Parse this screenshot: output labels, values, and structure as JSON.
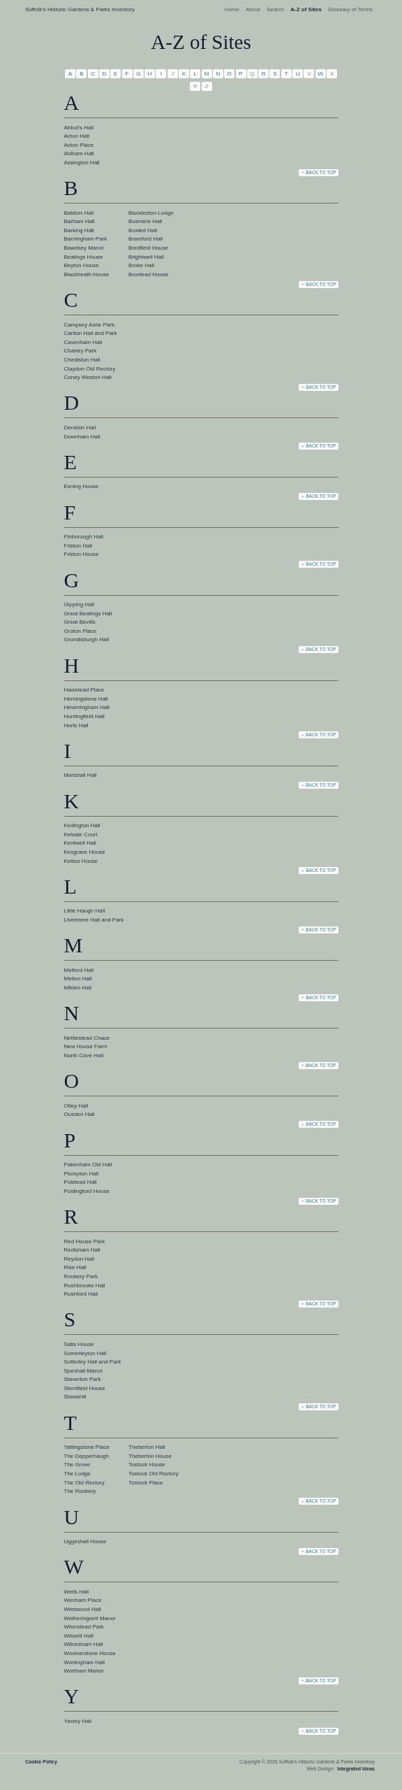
{
  "header": {
    "brand": "Suffolk's Historic Gardens & Parks Inventory",
    "nav": [
      {
        "label": "Home",
        "selected": false
      },
      {
        "label": "About",
        "selected": false
      },
      {
        "label": "Search",
        "selected": false
      },
      {
        "label": "A-Z of Sites",
        "selected": true
      },
      {
        "label": "Glossary of Terms",
        "selected": false
      }
    ]
  },
  "title": "A-Z of Sites",
  "letter_index": [
    {
      "label": "A",
      "disabled": false
    },
    {
      "label": "B",
      "disabled": false
    },
    {
      "label": "C",
      "disabled": false
    },
    {
      "label": "D",
      "disabled": false
    },
    {
      "label": "E",
      "disabled": false
    },
    {
      "label": "F",
      "disabled": false
    },
    {
      "label": "G",
      "disabled": false
    },
    {
      "label": "H",
      "disabled": false
    },
    {
      "label": "I",
      "disabled": false
    },
    {
      "label": "J",
      "disabled": true
    },
    {
      "label": "K",
      "disabled": false
    },
    {
      "label": "L",
      "disabled": false
    },
    {
      "label": "M",
      "disabled": false
    },
    {
      "label": "N",
      "disabled": false
    },
    {
      "label": "O",
      "disabled": false
    },
    {
      "label": "P",
      "disabled": false
    },
    {
      "label": "Q",
      "disabled": true
    },
    {
      "label": "R",
      "disabled": false
    },
    {
      "label": "S",
      "disabled": false
    },
    {
      "label": "T",
      "disabled": false
    },
    {
      "label": "U",
      "disabled": false
    },
    {
      "label": "V",
      "disabled": true
    },
    {
      "label": "W",
      "disabled": false
    },
    {
      "label": "X",
      "disabled": true
    },
    {
      "label": "Y",
      "disabled": false
    },
    {
      "label": "Z",
      "disabled": true
    }
  ],
  "sections": [
    {
      "letter": "A",
      "columns": [
        [
          "Abbot's Hall",
          "Acton Hall",
          "Acton Place",
          "Aldham Hall",
          "Assington Hall"
        ]
      ],
      "back_to_top": "BACK TO TOP"
    },
    {
      "letter": "B",
      "columns": [
        [
          "Balston Hall",
          "Barham Hall",
          "Barking Hall",
          "Barningham Park",
          "Bawdsey Manor",
          "Bealings House",
          "Beyton House",
          "Blackheath House"
        ],
        [
          "Blundeston Lodge",
          "Bosmere Hall",
          "Boxted Hall",
          "Bramford Hall",
          "Bredfield House",
          "Brightwell Hall",
          "Broke Hall",
          "Broxtead House"
        ]
      ],
      "back_to_top": "BACK TO TOP"
    },
    {
      "letter": "C",
      "columns": [
        [
          "Campsey Ashe Park",
          "Carlton Hall and Park",
          "Cavenham Hall",
          "Chantry Park",
          "Chediston Hall",
          "Claydon Old Rectory",
          "Coney Weston Hall"
        ]
      ],
      "back_to_top": "BACK TO TOP"
    },
    {
      "letter": "D",
      "columns": [
        [
          "Denston Hall",
          "Downham Hall"
        ]
      ],
      "back_to_top": "BACK TO TOP"
    },
    {
      "letter": "E",
      "columns": [
        [
          "Exning House"
        ]
      ],
      "back_to_top": "BACK TO TOP"
    },
    {
      "letter": "F",
      "columns": [
        [
          "Finborough Hall",
          "Friston Hall",
          "Friston House"
        ]
      ],
      "back_to_top": "BACK TO TOP"
    },
    {
      "letter": "G",
      "columns": [
        [
          "Gipping Hall",
          "Great Bealings Hall",
          "Great Bevills",
          "Groton Place",
          "Grundisburgh Hall"
        ]
      ],
      "back_to_top": "BACK TO TOP"
    },
    {
      "letter": "H",
      "columns": [
        [
          "Hawstead Place",
          "Hemingstone Hall",
          "Heveningham Hall",
          "Huntingfield Hall",
          "Hurts Hall"
        ]
      ],
      "back_to_top": "BACK TO TOP"
    },
    {
      "letter": "I",
      "columns": [
        [
          "Ilketshall Hall"
        ]
      ],
      "back_to_top": "BACK TO TOP"
    },
    {
      "letter": "K",
      "columns": [
        [
          "Kedington Hall",
          "Kelsale Court",
          "Kentwell Hall",
          "Kesgrave House",
          "Ketton House"
        ]
      ],
      "back_to_top": "BACK TO TOP"
    },
    {
      "letter": "L",
      "columns": [
        [
          "Little Haugh Hall",
          "Livermere Hall and Park"
        ]
      ],
      "back_to_top": "BACK TO TOP"
    },
    {
      "letter": "M",
      "columns": [
        [
          "Melford Hall",
          "Melton Hall",
          "Milden Hall"
        ]
      ],
      "back_to_top": "BACK TO TOP"
    },
    {
      "letter": "N",
      "columns": [
        [
          "Nettlestead Chace",
          "New House Farm",
          "North Cove Hall"
        ]
      ],
      "back_to_top": "BACK TO TOP"
    },
    {
      "letter": "O",
      "columns": [
        [
          "Otley Hall",
          "Ousden Hall"
        ]
      ],
      "back_to_top": "BACK TO TOP"
    },
    {
      "letter": "P",
      "columns": [
        [
          "Pakenham Old Hall",
          "Plumpton Hall",
          "Polstead Hall",
          "Poslingford House"
        ]
      ],
      "back_to_top": "BACK TO TOP"
    },
    {
      "letter": "R",
      "columns": [
        [
          "Red House Park",
          "Redisham Hall",
          "Reydon Hall",
          "Rise Hall",
          "Rookery Park",
          "Rushbrooke Hall",
          "Rushford Hall"
        ]
      ],
      "back_to_top": "BACK TO TOP"
    },
    {
      "letter": "S",
      "columns": [
        [
          "Satis House",
          "Somerleyton Hall",
          "Sotterley Hall and Park",
          "Spexhall Manor",
          "Staverton Park",
          "Sternfield House",
          "Stowehill"
        ]
      ],
      "back_to_top": "BACK TO TOP"
    },
    {
      "letter": "T",
      "columns": [
        [
          "Tattingstone Place",
          "The Depperhaugh",
          "The Grove",
          "The Lodge",
          "The Old Rectory",
          "The Rookery"
        ],
        [
          "Theberton Hall",
          "Theberton House",
          "Tostock House",
          "Tostock Old Rectory",
          "Tostock Place"
        ]
      ],
      "back_to_top": "BACK TO TOP"
    },
    {
      "letter": "U",
      "columns": [
        [
          "Uggeshall House"
        ]
      ],
      "back_to_top": "BACK TO TOP"
    },
    {
      "letter": "W",
      "columns": [
        [
          "Wells Hall",
          "Wenham Place",
          "Westwood Hall",
          "Wetheringsett Manor",
          "Wherstead Park",
          "Wissett Hall",
          "Witnesham Hall",
          "Woolverstone House",
          "Worlingham Hall",
          "Wortham Manor"
        ]
      ],
      "back_to_top": "BACK TO TOP"
    },
    {
      "letter": "Y",
      "columns": [
        [
          "Yaxley Hall"
        ]
      ],
      "back_to_top": "BACK TO TOP"
    }
  ],
  "footer": {
    "cookie_link": "Cookie Policy",
    "copyright": "Copyright © 2026 Suffolk's Historic Gardens & Parks Inventory",
    "credit_label": "Web Design:",
    "credit_link": "Integrated Ideas"
  }
}
